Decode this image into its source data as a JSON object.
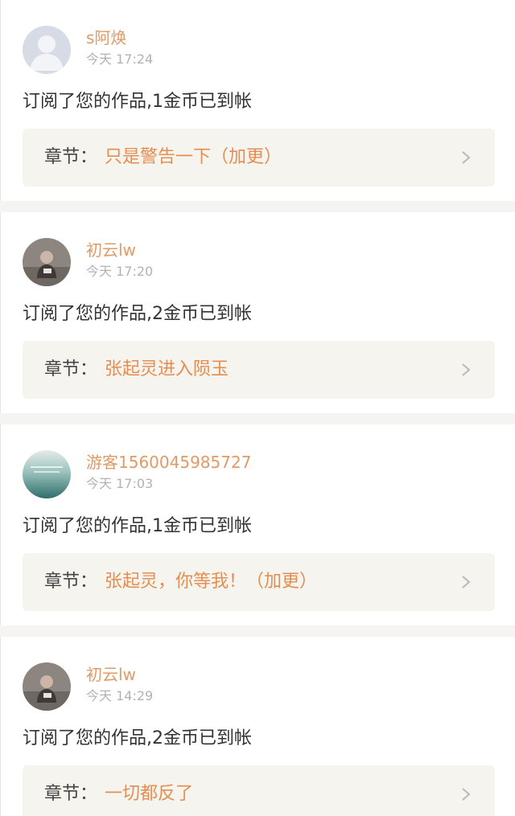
{
  "notifications": [
    {
      "avatar": "default-person-avatar",
      "username": "s阿焕",
      "time": "今天 17:24",
      "message": "订阅了您的作品,1金币已到帐",
      "chapter_label": "章节：",
      "chapter_title": "只是警告一下（加更）"
    },
    {
      "avatar": "photo-avatar-figure",
      "username": "初云lw",
      "time": "今天 17:20",
      "message": "订阅了您的作品,2金币已到帐",
      "chapter_label": "章节：",
      "chapter_title": "张起灵进入陨玉"
    },
    {
      "avatar": "photo-avatar-landscape",
      "username": "游客1560045985727",
      "time": "今天 17:03",
      "message": "订阅了您的作品,1金币已到帐",
      "chapter_label": "章节：",
      "chapter_title": "张起灵，你等我！（加更）"
    },
    {
      "avatar": "photo-avatar-figure",
      "username": "初云lw",
      "time": "今天 14:29",
      "message": "订阅了您的作品,2金币已到帐",
      "chapter_label": "章节：",
      "chapter_title": "一切都反了"
    }
  ],
  "colors": {
    "username": "#e09a66",
    "chapter_title": "#e58e52",
    "time": "#b2b2b2",
    "chapter_box_bg": "#f5f4ee",
    "page_bg": "#f5f4f3"
  }
}
